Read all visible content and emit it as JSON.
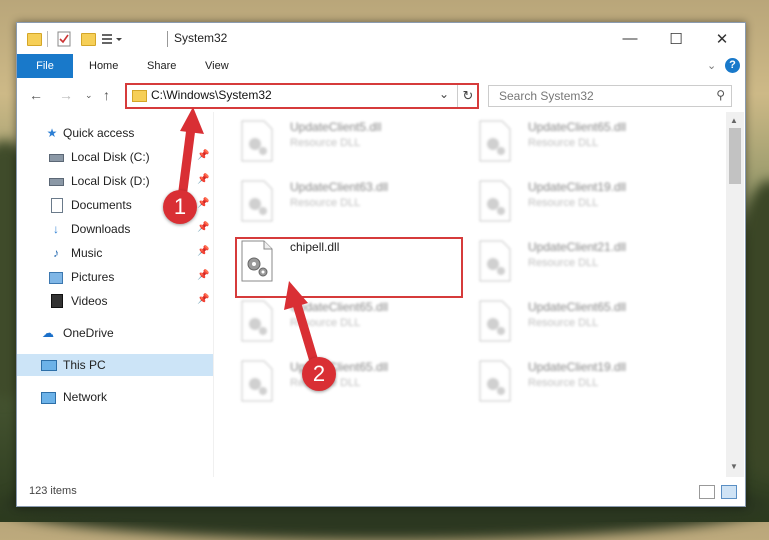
{
  "window": {
    "title": "System32",
    "quick_access_toolbar": [
      "folder-icon",
      "properties-icon",
      "new-folder-icon",
      "customize-icon"
    ],
    "controls": {
      "minimize": "—",
      "maximize": "☐",
      "close": "✕"
    }
  },
  "ribbon": {
    "tabs": [
      "File",
      "Home",
      "Share",
      "View"
    ],
    "expand_icon": "chevron-down-icon",
    "help_icon": "help-icon"
  },
  "address": {
    "path": "C:\\Windows\\System32",
    "search_placeholder": "Search System32"
  },
  "sidebar": {
    "items": [
      {
        "label": "Quick access",
        "icon": "star-icon",
        "pinned": false
      },
      {
        "label": "Local Disk (C:)",
        "icon": "drive-icon",
        "pinned": true
      },
      {
        "label": "Local Disk (D:)",
        "icon": "drive-icon",
        "pinned": true
      },
      {
        "label": "Documents",
        "icon": "documents-icon",
        "pinned": true
      },
      {
        "label": "Downloads",
        "icon": "download-icon",
        "pinned": true
      },
      {
        "label": "Music",
        "icon": "music-icon",
        "pinned": true
      },
      {
        "label": "Pictures",
        "icon": "pictures-icon",
        "pinned": true
      },
      {
        "label": "Videos",
        "icon": "videos-icon",
        "pinned": true
      },
      {
        "label": "OneDrive",
        "icon": "cloud-icon",
        "pinned": false
      },
      {
        "label": "This PC",
        "icon": "computer-icon",
        "pinned": false,
        "selected": true
      },
      {
        "label": "Network",
        "icon": "network-icon",
        "pinned": false
      }
    ]
  },
  "files": [
    {
      "name": "UpdateClient5.dll",
      "type": "Resource DLL"
    },
    {
      "name": "UpdateClient65.dll",
      "type": "Resource DLL"
    },
    {
      "name": "UpdateClient63.dll",
      "type": "Resource DLL"
    },
    {
      "name": "UpdateClient19.dll",
      "type": "Resource DLL"
    },
    {
      "name": "chipell.dll",
      "type": ""
    },
    {
      "name": "UpdateClient21.dll",
      "type": "Resource DLL"
    },
    {
      "name": "UpdateClient65.dll",
      "type": "Resource DLL"
    },
    {
      "name": "UpdateClient65.dll",
      "type": "Resource DLL"
    },
    {
      "name": "UpdateClient65.dll",
      "type": "Resource DLL"
    },
    {
      "name": "UpdateClient19.dll",
      "type": "Resource DLL"
    }
  ],
  "status": {
    "item_count": "123 items"
  },
  "annotations": {
    "step1": "1",
    "step2": "2",
    "highlight_color": "#d63b3b",
    "badge_color": "#d92f34"
  }
}
